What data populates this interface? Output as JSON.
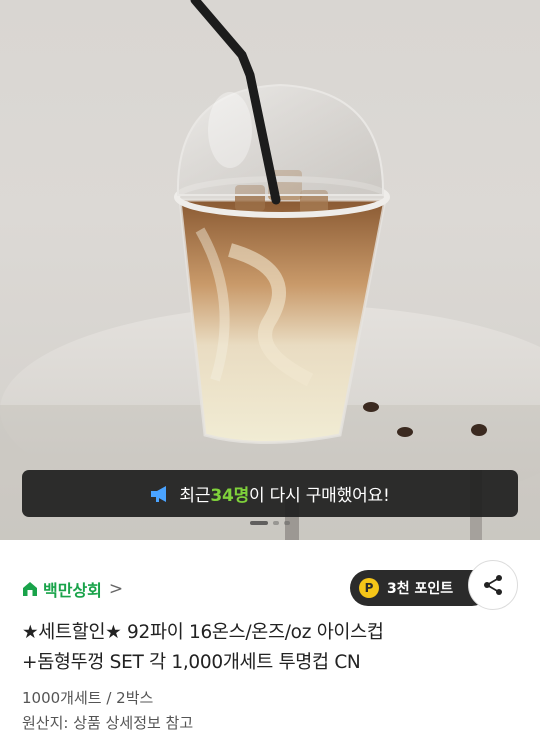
{
  "notice": {
    "prefix": "최근 ",
    "count": "34명",
    "suffix": "이 다시 구매했어요!",
    "icon": "megaphone-icon"
  },
  "carousel": {
    "total": 3,
    "active": 1
  },
  "store": {
    "name": "백만상회",
    "icon": "store-home-icon",
    "chevron": ">"
  },
  "points": {
    "badge": "P",
    "label": "3천 포인트"
  },
  "share": {
    "icon": "share-icon"
  },
  "product": {
    "title_line1": "★세트할인★ 92파이 16온스/온즈/oz 아이스컵",
    "title_line2": "+돔형뚜껑 SET 각 1,000개세트 투명컵 CN",
    "quantity": "1000개세트 / 2박스",
    "origin": "원산지: 상품 상세정보 참고"
  },
  "colors": {
    "accent": "#19a34a",
    "highlight": "#7fd13b",
    "coin": "#f5c518"
  }
}
